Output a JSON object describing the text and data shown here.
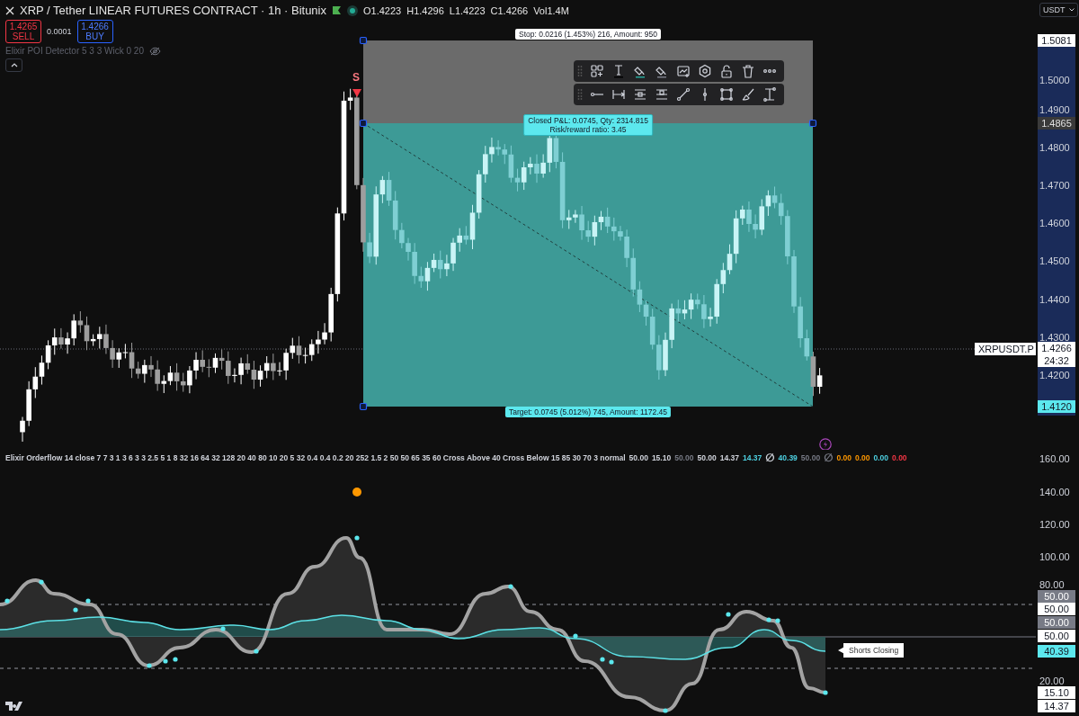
{
  "header": {
    "title": "XRP / Tether LINEAR FUTURES CONTRACT · 1h · Bitunix",
    "ohlc": [
      "O1.4223",
      "H1.4296",
      "L1.4223",
      "C1.4266",
      "Vol1.4M"
    ]
  },
  "order_panel": {
    "sell": {
      "price": "1.4265",
      "label": "SELL"
    },
    "spread": "0.0001",
    "buy": {
      "price": "1.4266",
      "label": "BUY"
    }
  },
  "indicator": {
    "label": "Elixir POI Detector 5 3 3 Wick 0 20"
  },
  "currency": "USDT",
  "signal": {
    "label": "S"
  },
  "position": {
    "stop_label": "Stop: 0.0216 (1.453%) 216, Amount: 950",
    "pnl_label": "Closed P&L: 0.0745, Qty: 2314.815",
    "ratio_label": "Risk/reward ratio: 3.45",
    "target_label": "Target: 0.0745 (5.012%) 745, Amount: 1172.45"
  },
  "price_axis": {
    "ticks": [
      "1.5000",
      "1.4900",
      "1.4800",
      "1.4700",
      "1.4600",
      "1.4500",
      "1.4400",
      "1.4300",
      "1.4200"
    ],
    "markers": [
      {
        "value": "1.5081",
        "kind": "plain"
      },
      {
        "value": "1.4865",
        "kind": "shaded"
      },
      {
        "value": "1.4120",
        "kind": "accent"
      }
    ],
    "last": {
      "symbol": "XRPUSDT.P",
      "price": "1.4266",
      "countdown": "24:32"
    }
  },
  "oscillator": {
    "legend": [
      {
        "text": "Elixir Orderflow 14 close 7 7 3 1 3 6 3 3 2.5 5 1 8 32 16 64 32 128 20 40 80 10 20 5 32 0.4 0.4 0.2 20 252 1.5 2 50 50 65 35 60 Cross Above 40 Cross Below 15 85 30 70 3 normal",
        "color": "#d1d4dc"
      },
      {
        "text": "50.00",
        "color": "#d1d4dc"
      },
      {
        "text": "15.10",
        "color": "#d1d4dc"
      },
      {
        "text": "50.00",
        "color": "#787b86"
      },
      {
        "text": "50.00",
        "color": "#d1d4dc"
      },
      {
        "text": "14.37",
        "color": "#d1d4dc"
      },
      {
        "text": "14.37",
        "color": "#4dd0e1"
      },
      {
        "text": "∅",
        "color": "#d1d4dc"
      },
      {
        "text": "40.39",
        "color": "#4dd0e1"
      },
      {
        "text": "50.00",
        "color": "#787b86"
      },
      {
        "text": "∅",
        "color": "#787b86"
      },
      {
        "text": "0.00",
        "color": "#ff9800"
      },
      {
        "text": "0.00",
        "color": "#ff9800"
      },
      {
        "text": "0.00",
        "color": "#4dd0e1"
      },
      {
        "text": "0.00",
        "color": "#f23645"
      }
    ],
    "ticks": [
      "160.00",
      "140.00",
      "120.00",
      "100.00",
      "80.00",
      "20.00"
    ],
    "labels": [
      {
        "value": "50.00",
        "kind": "shaded"
      },
      {
        "value": "50.00",
        "kind": "plain"
      },
      {
        "value": "50.00",
        "kind": "shaded"
      },
      {
        "value": "50.00",
        "kind": "plain"
      },
      {
        "value": "40.39",
        "kind": "accent"
      },
      {
        "value": "15.10",
        "kind": "plain"
      },
      {
        "value": "14.37",
        "kind": "plain"
      }
    ],
    "callout": "Shorts Closing"
  }
}
